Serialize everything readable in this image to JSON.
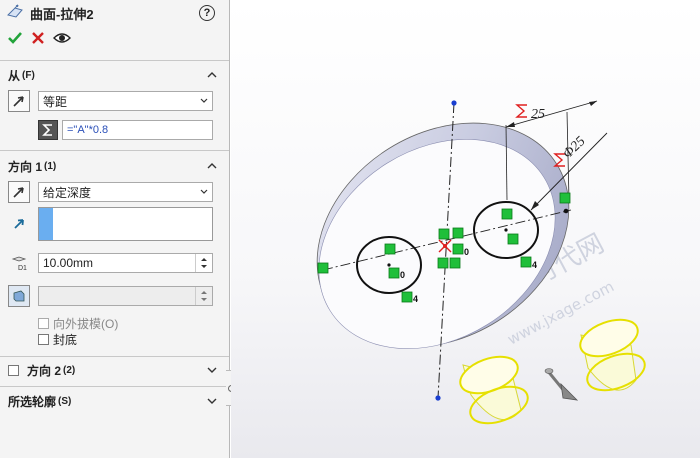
{
  "feature": {
    "title": "曲面-拉伸2",
    "help_glyph": "?",
    "icons": [
      "surface-extrude-icon",
      "ok-check-icon",
      "cancel-x-icon",
      "preview-eye-icon"
    ]
  },
  "from_section": {
    "title": "从",
    "key": "(F)",
    "type_value": "等距",
    "equation_value": "=\"A\"*0.8"
  },
  "direction1": {
    "title": "方向 1",
    "key": "(1)",
    "end_condition": "给定深度",
    "depth_value": "10.00mm",
    "draft_label": "向外拔模(O)",
    "cap_end_label": "封底"
  },
  "direction2": {
    "title": "方向 2",
    "key": "(2)"
  },
  "selected_contours": {
    "title": "所选轮廓",
    "key": "(S)"
  },
  "viewport": {
    "dim1": "25",
    "dim2": "Φ25",
    "relation_values": [
      "0",
      "0",
      "4",
      "4"
    ],
    "watermark_cn": "机械时代网",
    "watermark_url": "www.jxage.com",
    "accent_green": "#1fbf3a",
    "preview_yellow": "#ffff66"
  }
}
